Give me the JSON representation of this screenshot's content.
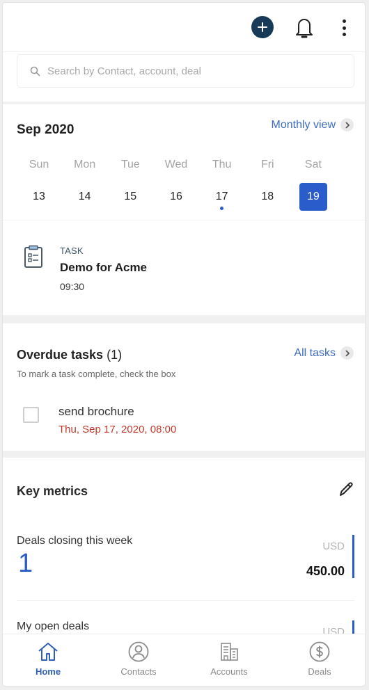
{
  "header": {
    "add_icon": "plus-circle-icon",
    "notifications_icon": "bell-icon",
    "menu_icon": "kebab-menu-icon"
  },
  "search": {
    "placeholder": "Search by Contact, account, deal",
    "value": "",
    "icon": "search-icon"
  },
  "calendar": {
    "title": "Sep 2020",
    "monthly_view_label": "Monthly view",
    "weekdays": [
      "Sun",
      "Mon",
      "Tue",
      "Wed",
      "Thu",
      "Fri",
      "Sat"
    ],
    "days": [
      {
        "num": "13",
        "selected": false,
        "has_event": false
      },
      {
        "num": "14",
        "selected": false,
        "has_event": false
      },
      {
        "num": "15",
        "selected": false,
        "has_event": false
      },
      {
        "num": "16",
        "selected": false,
        "has_event": false
      },
      {
        "num": "17",
        "selected": false,
        "has_event": true
      },
      {
        "num": "18",
        "selected": false,
        "has_event": false
      },
      {
        "num": "19",
        "selected": true,
        "has_event": false
      }
    ]
  },
  "agenda": {
    "type": "TASK",
    "title": "Demo for Acme",
    "time": "09:30",
    "icon": "clipboard-list-icon"
  },
  "overdue": {
    "title": "Overdue tasks",
    "count": "(1)",
    "subtitle": "To mark a task complete, check the box",
    "all_tasks_label": "All tasks",
    "tasks": [
      {
        "name": "send brochure",
        "due": "Thu, Sep 17, 2020, 08:00",
        "checked": false
      }
    ]
  },
  "metrics": {
    "title": "Key metrics",
    "edit_icon": "pencil-icon",
    "items": [
      {
        "label": "Deals closing this week",
        "count": "1",
        "currency": "USD",
        "amount": "450.00"
      },
      {
        "label": "My open deals",
        "currency": "USD"
      }
    ]
  },
  "bottom_nav": {
    "items": [
      {
        "label": "Home",
        "icon": "home-icon",
        "active": true
      },
      {
        "label": "Contacts",
        "icon": "contact-icon",
        "active": false
      },
      {
        "label": "Accounts",
        "icon": "building-icon",
        "active": false
      },
      {
        "label": "Deals",
        "icon": "dollar-circle-icon",
        "active": false
      }
    ]
  },
  "colors": {
    "accent": "#2b5ccc",
    "link": "#3c6bc1",
    "add_button": "#163a57",
    "overdue_date": "#c0392b"
  }
}
